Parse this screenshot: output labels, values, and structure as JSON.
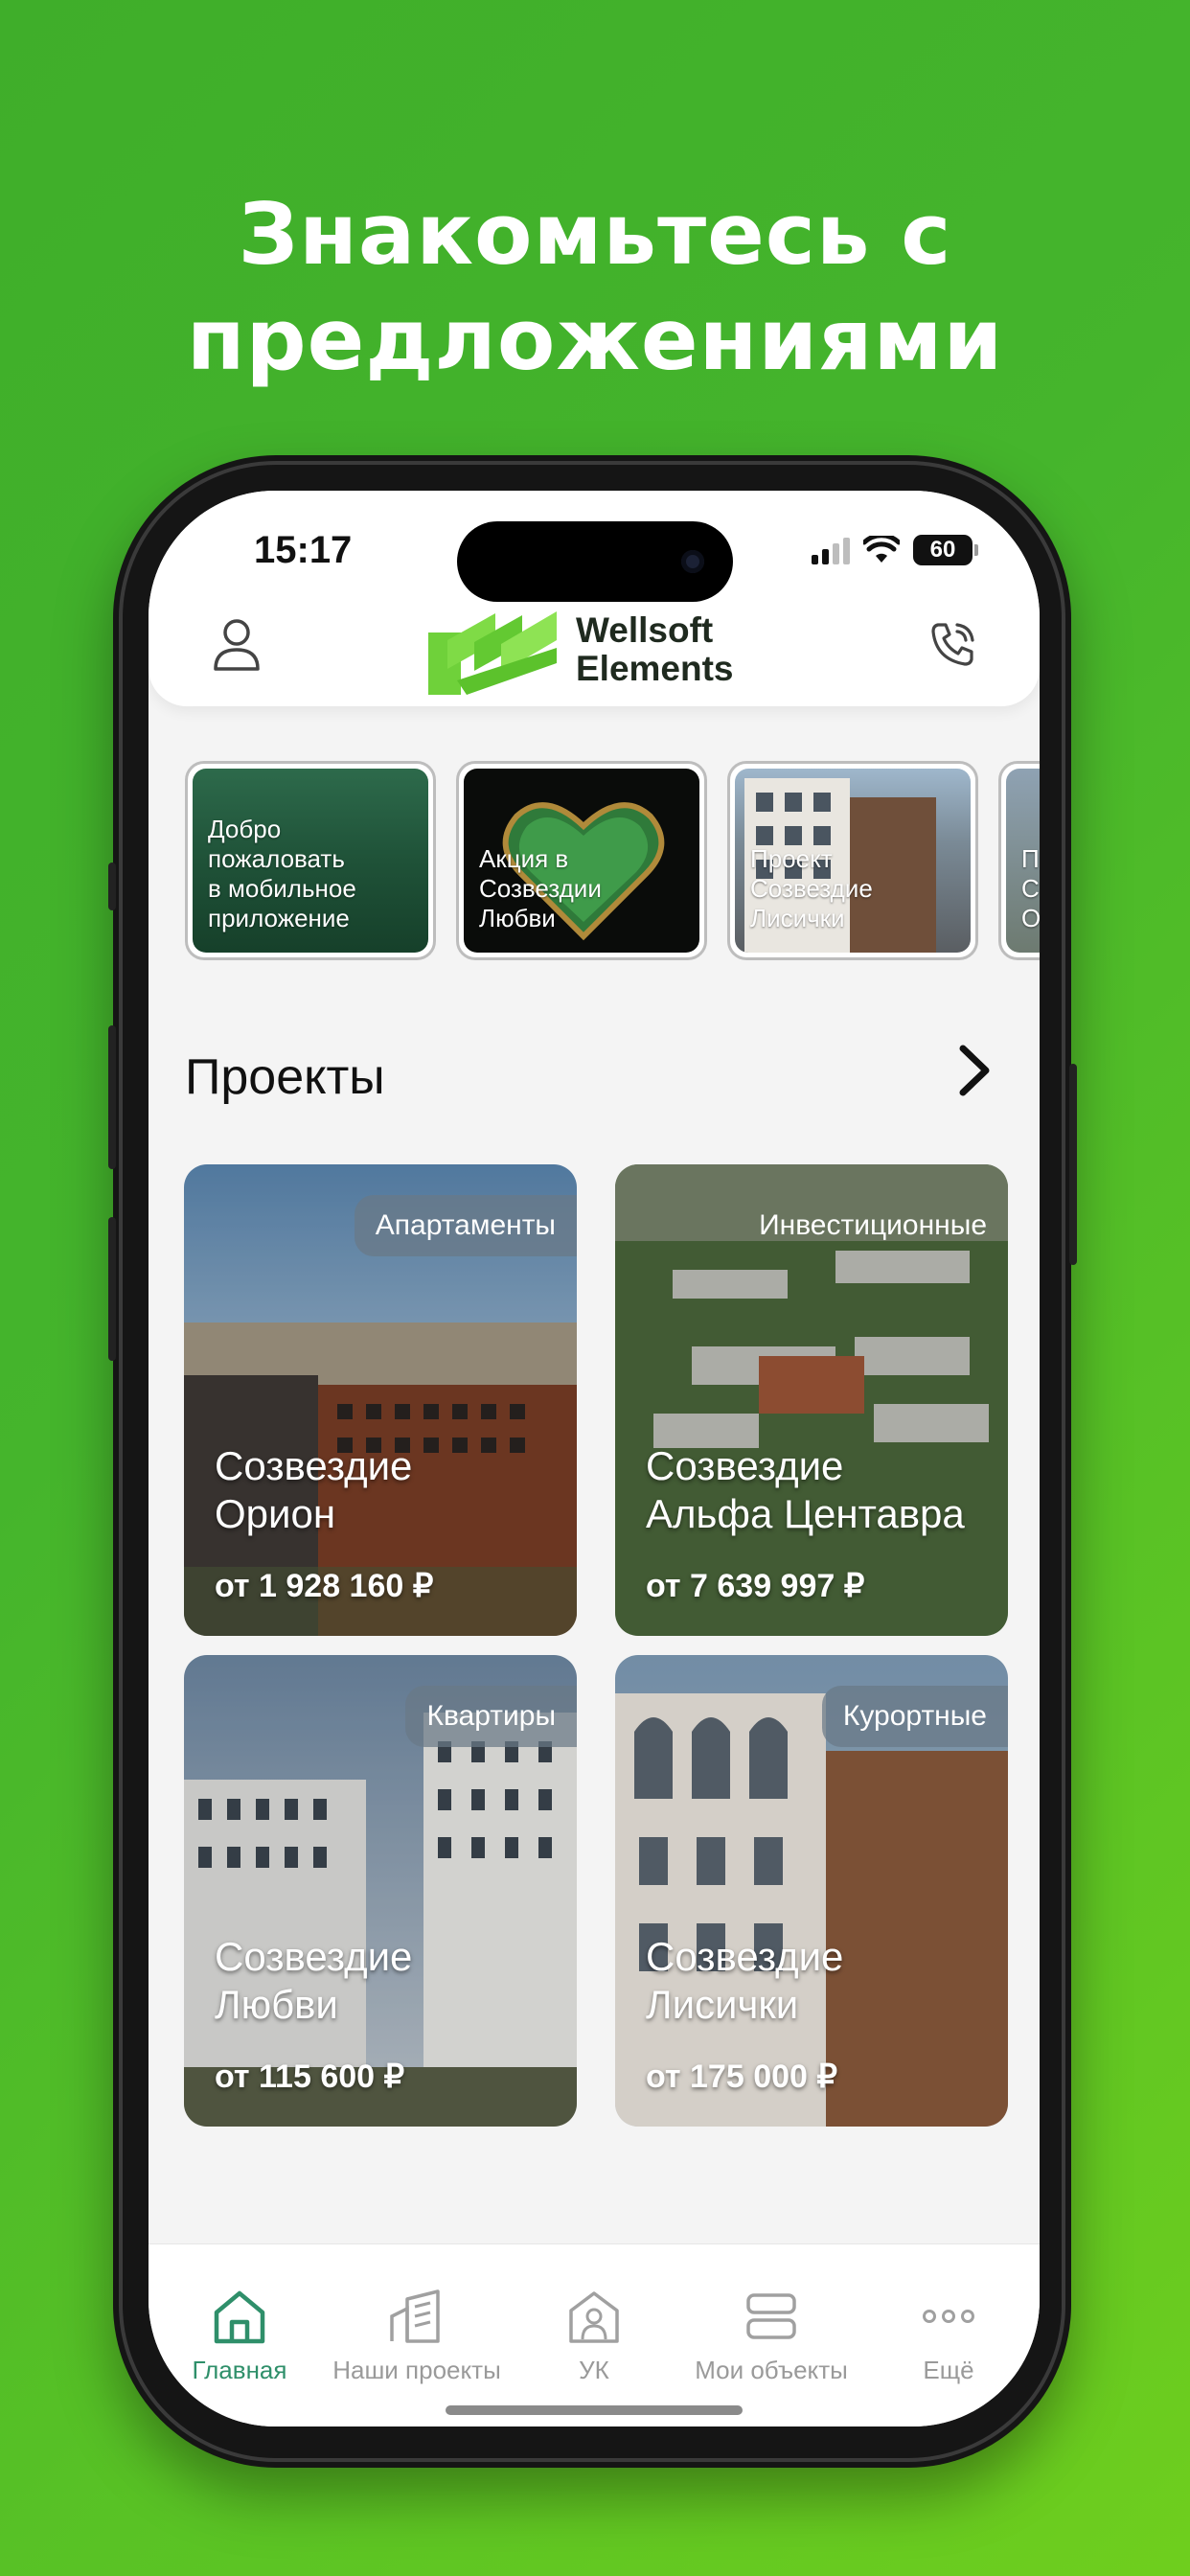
{
  "promo": {
    "line1": "Знакомьтесь с",
    "line2": "предложениями"
  },
  "status_bar": {
    "time": "15:17",
    "battery": "60"
  },
  "app_bar": {
    "logo_line1": "Wellsoft",
    "logo_line2": "Elements",
    "icons": [
      "profile-icon",
      "phone-call-icon"
    ]
  },
  "stories": [
    {
      "text": "Добро пожаловать в мобильное приложение",
      "lines": [
        "Добро",
        "пожаловать",
        "в мобильное",
        "приложение"
      ]
    },
    {
      "text": "Акция в Созвездии Любви",
      "lines": [
        "Акция в",
        "Созвездии",
        "Любви"
      ]
    },
    {
      "text": "Проект Созвездие Лисички",
      "lines": [
        "Проект",
        "Созвездие",
        "Лисички"
      ]
    },
    {
      "text": "Пр Со Ор",
      "lines": [
        "Пр",
        "Со",
        "Ор"
      ]
    }
  ],
  "projects_section": {
    "title": "Проекты"
  },
  "projects": [
    {
      "tag": "Апартаменты",
      "title_l1": "Созвездие",
      "title_l2": "Орион",
      "price": "от 1 928 160 ₽"
    },
    {
      "tag": "Инвестиционные",
      "title_l1": "Созвездие",
      "title_l2": "Альфа Центавра",
      "price": "от 7 639 997 ₽"
    },
    {
      "tag": "Квартиры",
      "title_l1": "Созвездие",
      "title_l2": "Любви",
      "price": "от 115 600 ₽"
    },
    {
      "tag": "Курортные",
      "title_l1": "Созвездие",
      "title_l2": "Лисички",
      "price": "от 175 000 ₽"
    }
  ],
  "tab_bar": {
    "active_color": "#2f8f6a",
    "items": [
      {
        "label": "Главная",
        "icon": "home-icon",
        "active": true
      },
      {
        "label": "Наши проекты",
        "icon": "buildings-icon",
        "active": false
      },
      {
        "label": "УК",
        "icon": "management-company-icon",
        "active": false
      },
      {
        "label": "Мои объекты",
        "icon": "objects-icon",
        "active": false
      },
      {
        "label": "Ещё",
        "icon": "more-icon",
        "active": false
      }
    ]
  },
  "colors": {
    "brand_green": "#5fc93a",
    "background_green": "#45b52c"
  }
}
